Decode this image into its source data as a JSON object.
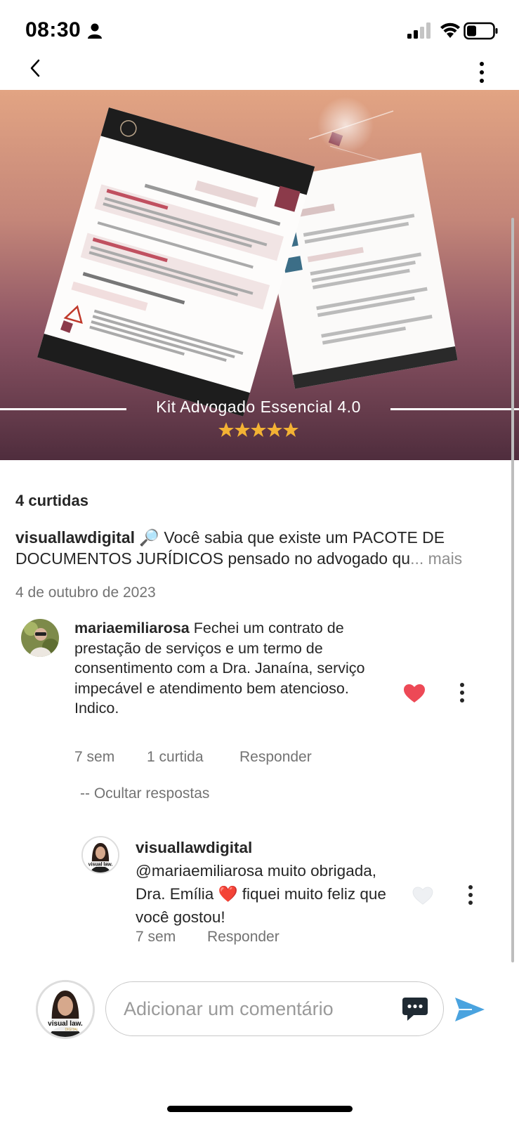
{
  "status_bar": {
    "time": "08:30"
  },
  "post": {
    "image_title": "Kit Advogado Essencial 4.0",
    "rating_stars": 5,
    "likes": "4 curtidas",
    "author": "visuallawdigital",
    "caption_emoji": "🔎",
    "caption_text": " Você sabia que existe um PACOTE DE DOCUMENTOS JURÍDICOS pensado no advogado qu",
    "caption_more": "... mais",
    "date": "4 de outubro de 2023"
  },
  "comments": [
    {
      "username": "mariaemiliarosa",
      "text": "Fechei um contrato de prestação de serviços e um termo de consentimento com a Dra. Janaína, serviço impecável e atendimento bem atencioso.",
      "text_line2": "Indico.",
      "time": "7 sem",
      "likes": "1 curtida",
      "reply_label": "Responder",
      "liked": true,
      "hide_replies_label": "-- Ocultar respostas",
      "replies": [
        {
          "username": "visuallawdigital",
          "text": "@mariaemiliarosa muito obrigada, Dra. Emília ❤️ fiquei muito feliz que você gostou!",
          "time": "7 sem",
          "reply_label": "Responder",
          "liked": false
        }
      ]
    }
  ],
  "footer": {
    "input_placeholder": "Adicionar um comentário",
    "avatar_label": "visual law.",
    "avatar_sublabel": "DIGITAL"
  },
  "colors": {
    "like_red": "#ed4956",
    "send_blue": "#4aa3df"
  }
}
